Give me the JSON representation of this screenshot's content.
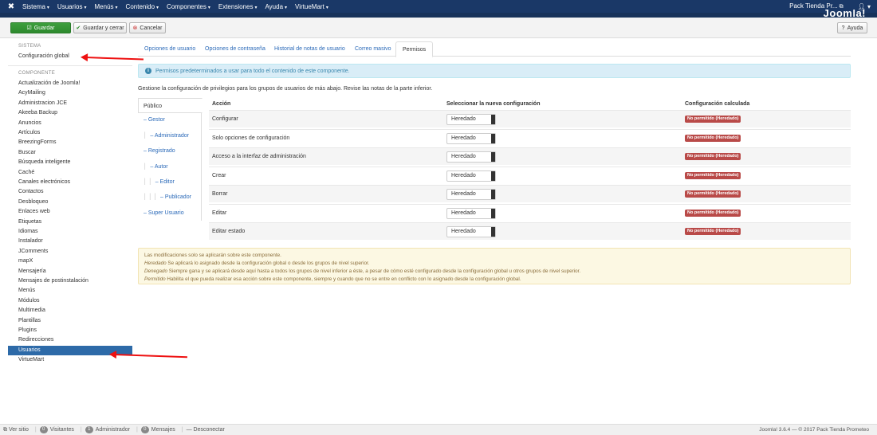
{
  "navbar": {
    "menus": [
      "Sistema",
      "Usuarios",
      "Menús",
      "Contenido",
      "Componentes",
      "Extensiones",
      "Ayuda",
      "VirtueMart"
    ],
    "site_name": "Pack Tienda Pr...",
    "user_icon": "user-icon",
    "wordmark": "Joomla!"
  },
  "toolbar": {
    "save": "Guardar",
    "save_close": "Guardar y cerrar",
    "cancel": "Cancelar",
    "help": "Ayuda"
  },
  "sidebar": {
    "system_header": "SISTEMA",
    "global_config": "Configuración global",
    "component_header": "COMPONENTE",
    "components": [
      "Actualización de Joomla!",
      "AcyMailing",
      "Administracion JCE",
      "Akeeba Backup",
      "Anuncios",
      "Artículos",
      "BreezingForms",
      "Buscar",
      "Búsqueda inteligente",
      "Caché",
      "Canales electrónicos",
      "Contactos",
      "Desbloqueo",
      "Enlaces web",
      "Etiquetas",
      "Idiomas",
      "Instalador",
      "JComments",
      "mapX",
      "Mensajería",
      "Mensajes de postinstalación",
      "Menús",
      "Módulos",
      "Multimedia",
      "Plantillas",
      "Plugins",
      "Redirecciones",
      "Usuarios",
      "VirtueMart"
    ],
    "active": "Usuarios"
  },
  "tabs": [
    "Opciones de usuario",
    "Opciones de contraseña",
    "Historial de notas de usuario",
    "Correo masivo",
    "Permisos"
  ],
  "active_tab": "Permisos",
  "info_message": "Permisos predeterminados a usar para todo el contenido de este componente.",
  "description": "Gestione la configuración de privilegios para los grupos de usuarios de más abajo. Revise las notas de la parte inferior.",
  "groups": [
    {
      "label": "Público",
      "prefix": ""
    },
    {
      "label": "– Gestor",
      "prefix": ""
    },
    {
      "label": "– Administrador",
      "prefix": "│"
    },
    {
      "label": "– Registrado",
      "prefix": ""
    },
    {
      "label": "– Autor",
      "prefix": "│"
    },
    {
      "label": "– Editor",
      "prefix": "│ │"
    },
    {
      "label": "– Publicador",
      "prefix": "│ │ │"
    },
    {
      "label": "– Super Usuario",
      "prefix": ""
    }
  ],
  "table": {
    "col_action": "Acción",
    "col_new": "Seleccionar la nueva configuración",
    "col_calc": "Configuración calculada",
    "rows": [
      {
        "action": "Configurar",
        "setting": "Heredado",
        "calculated": "No permitido (Heredado)"
      },
      {
        "action": "Solo opciones de configuración",
        "setting": "Heredado",
        "calculated": "No permitido (Heredado)"
      },
      {
        "action": "Acceso a la interfaz de administración",
        "setting": "Heredado",
        "calculated": "No permitido (Heredado)"
      },
      {
        "action": "Crear",
        "setting": "Heredado",
        "calculated": "No permitido (Heredado)"
      },
      {
        "action": "Borrar",
        "setting": "Heredado",
        "calculated": "No permitido (Heredado)"
      },
      {
        "action": "Editar",
        "setting": "Heredado",
        "calculated": "No permitido (Heredado)"
      },
      {
        "action": "Editar estado",
        "setting": "Heredado",
        "calculated": "No permitido (Heredado)"
      }
    ]
  },
  "notes": {
    "line1": "Las modificaciones solo se aplicarán sobre este componente.",
    "inherited_term": "Heredado",
    "inherited_text": " Se aplicará lo asignado desde la configuración global o desde los grupos de nivel superior.",
    "denied_term": "Denegado",
    "denied_text": " Siempre gana y se aplicará desde aquí hasta a todos los grupos de nivel inferior a éste, a pesar de cómo esté configurado desde la configuración global u otros grupos de nivel superior.",
    "allowed_term": "Permitido",
    "allowed_text": " Habilita el que pueda realizar esa acción sobre este componente, siempre y cuando que no se entre en conflicto con lo asignado desde la configuración global."
  },
  "statusbar": {
    "view_site": "Ver sitio",
    "visitors_count": "0",
    "visitors": "Visitantes",
    "admin_count": "1",
    "admin": "Administrador",
    "messages_count": "0",
    "messages": "Mensajes",
    "logout": "Desconectar",
    "version": "Joomla! 3.6.4 — © 2017 Pack Tienda Prometeo"
  },
  "colors": {
    "navbar": "#1a3867",
    "save_button": "#2e8a2e",
    "active_item": "#2d6aa8",
    "badge_denied": "#b94a48",
    "annotation_arrow": "#ee1111"
  }
}
